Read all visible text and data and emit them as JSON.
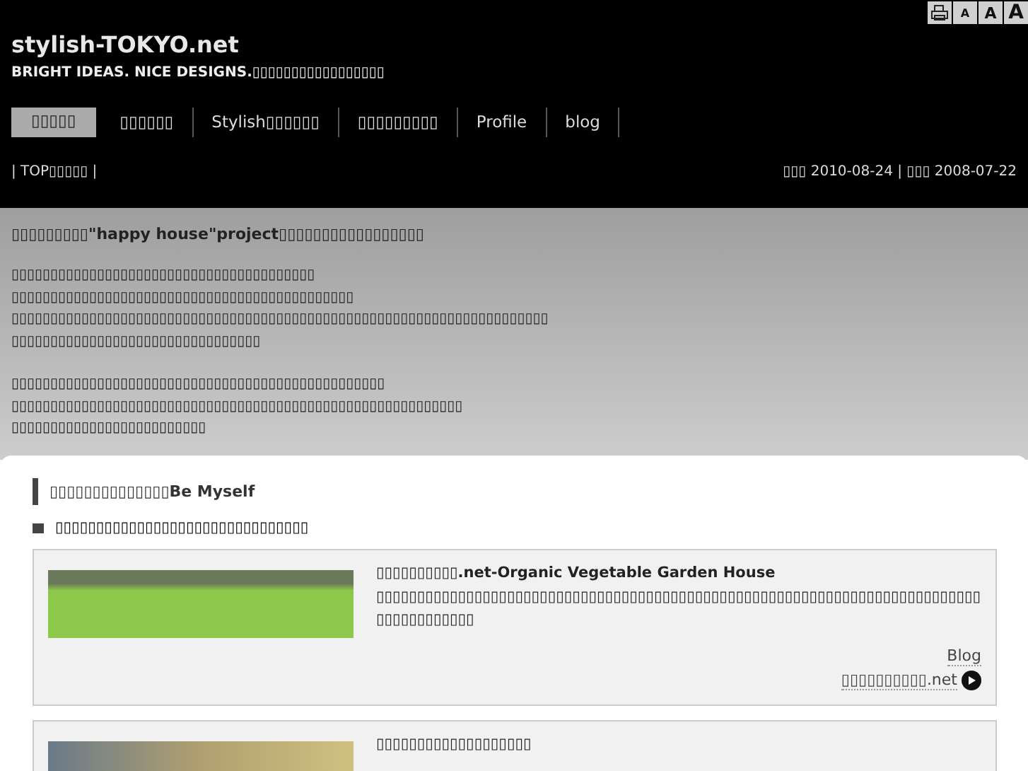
{
  "toolbar": {
    "buttons": [
      {
        "kind": "print"
      },
      {
        "kind": "small",
        "label": "A"
      },
      {
        "kind": "medium",
        "label": "A"
      },
      {
        "kind": "large",
        "label": "A"
      }
    ]
  },
  "header": {
    "title": "stylish-TOKYO.net",
    "tagline": "BRIGHT IDEAS. NICE DESIGNS.▯▯▯▯▯▯▯▯▯▯▯▯▯▯▯▯▯"
  },
  "nav": [
    {
      "label": "▯▯▯▯▯",
      "selected": true
    },
    {
      "label": "▯▯▯▯▯▯",
      "selected": false
    },
    {
      "label": "Stylish▯▯▯▯▯▯",
      "selected": false
    },
    {
      "label": "▯▯▯▯▯▯▯▯▯",
      "selected": false
    },
    {
      "label": "Profile",
      "selected": false
    },
    {
      "label": "blog",
      "selected": false
    }
  ],
  "breadcrumb": "| TOP▯▯▯▯▯ |",
  "dates": "▯▯▯ 2010-08-24 | ▯▯▯ 2008-07-22",
  "intro": {
    "lead": "▯▯▯▯▯▯▯▯▯**\"happy house\"project**▯▯▯▯▯▯▯▯▯▯▯▯▯▯▯▯▯",
    "paragraphs": [
      [
        "▯▯▯▯▯▯▯▯▯▯▯▯▯▯▯▯▯▯▯▯▯▯▯▯▯▯▯▯▯▯▯▯▯▯▯▯▯▯▯",
        "▯▯▯▯▯▯▯▯▯▯▯▯▯▯▯▯▯▯▯▯▯▯▯▯▯▯▯▯▯▯▯▯▯▯▯▯▯▯▯▯▯▯▯▯",
        "▯▯▯▯▯▯▯▯▯▯▯▯▯▯▯▯▯▯▯▯▯▯▯▯▯▯▯▯▯▯▯▯▯▯▯▯▯▯▯▯▯▯▯▯▯▯▯▯▯▯▯▯▯▯▯▯▯▯▯▯▯▯▯▯▯▯▯▯▯",
        "▯▯▯▯▯▯▯▯▯▯▯▯▯▯▯▯▯▯▯▯▯▯▯▯▯▯▯▯▯▯▯▯"
      ],
      [
        "▯▯▯▯▯▯▯▯▯▯▯▯▯▯▯▯▯▯▯▯▯▯▯▯▯▯▯▯▯▯▯▯▯▯▯▯▯▯▯▯▯▯▯▯▯▯▯▯",
        "▯▯▯▯▯▯▯▯▯▯▯▯▯▯▯▯▯▯▯▯▯▯▯▯▯▯▯▯▯▯▯▯▯▯▯▯▯▯▯▯▯▯▯▯▯▯▯▯▯▯▯▯▯▯▯▯▯▯",
        "▯▯▯▯▯▯▯▯▯▯▯▯▯▯▯▯▯▯▯▯▯▯▯▯▯"
      ]
    ]
  },
  "section": {
    "heading": "▯▯▯▯▯▯▯▯▯▯▯▯▯▯Be Myself",
    "subheading": "▯▯▯▯▯▯▯▯▯▯▯▯▯▯▯▯▯▯▯▯▯▯▯▯▯▯▯▯▯▯▯",
    "cards": [
      {
        "title": "▯▯▯▯▯▯▯▯▯▯.net-Organic Vegetable Garden House",
        "description": "▯▯▯▯▯▯▯▯▯▯▯▯▯▯▯▯▯▯▯▯▯▯▯▯▯▯▯▯▯▯▯▯▯▯▯▯▯▯▯▯▯▯▯▯▯▯▯▯▯▯▯▯▯▯▯▯▯▯▯▯▯▯▯▯▯▯▯▯▯▯▯▯▯▯▯▯▯▯▯▯▯▯▯▯▯▯",
        "links": [
          "Blog",
          "▯▯▯▯▯▯▯▯▯▯.net"
        ]
      },
      {
        "title": "▯▯▯▯▯▯▯▯▯▯▯▯▯▯▯▯▯▯▯"
      }
    ]
  }
}
